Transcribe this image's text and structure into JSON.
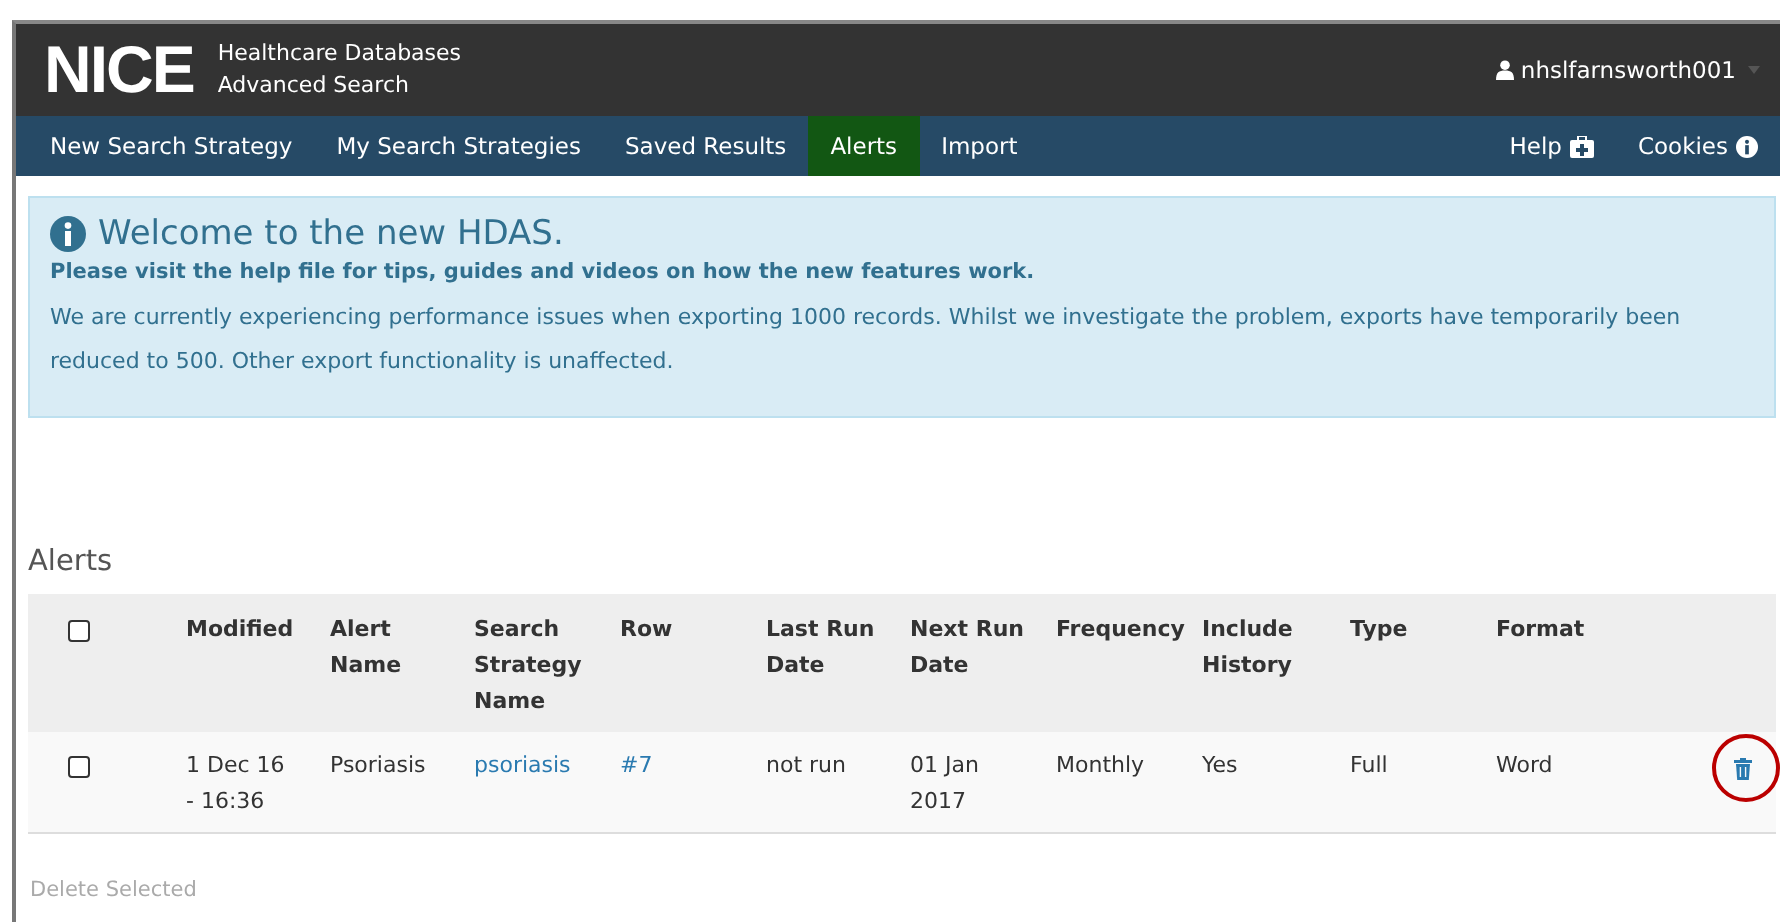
{
  "header": {
    "logo": "NICE",
    "title_lines": [
      "Healthcare Databases",
      "Advanced Search"
    ],
    "user": "nhslfarnsworth001"
  },
  "nav": {
    "items": [
      {
        "label": "New Search Strategy",
        "selected": false
      },
      {
        "label": "My Search Strategies",
        "selected": false
      },
      {
        "label": "Saved Results",
        "selected": false
      },
      {
        "label": "Alerts",
        "selected": true
      },
      {
        "label": "Import",
        "selected": false
      }
    ],
    "right_items": [
      {
        "label": "Help",
        "kind": "medkit"
      },
      {
        "label": "Cookies",
        "kind": "info"
      }
    ]
  },
  "notice": {
    "title": "Welcome to the new HDAS.",
    "subtitle": "Please visit the help file for tips, guides and videos on how the new features work.",
    "message": "We are currently experiencing performance issues when exporting 1000 records. Whilst we investigate the problem, exports have temporarily been reduced to 500. Other export functionality is unaffected."
  },
  "section_title": "Alerts",
  "table": {
    "select_all_checked": false,
    "columns": [
      "Modified",
      "Alert Name",
      "Search Strategy Name",
      "Row",
      "Last Run Date",
      "Next Run Date",
      "Frequency",
      "Include History",
      "Type",
      "Format"
    ],
    "rows": [
      {
        "checked": false,
        "cells": [
          {
            "text": "1 Dec 16 - 16:36",
            "kind": "text"
          },
          {
            "text": "Psoriasis",
            "kind": "text"
          },
          {
            "text": "psoriasis",
            "kind": "link"
          },
          {
            "text": "#7",
            "kind": "link"
          },
          {
            "text": "not run",
            "kind": "text"
          },
          {
            "text": "01 Jan 2017",
            "kind": "text"
          },
          {
            "text": "Monthly",
            "kind": "text"
          },
          {
            "text": "Yes",
            "kind": "text"
          },
          {
            "text": "Full",
            "kind": "text"
          },
          {
            "text": "Word",
            "kind": "text"
          }
        ],
        "highlighted_delete": true
      }
    ]
  },
  "delete_selected": {
    "label": "Delete Selected",
    "disabled": true
  }
}
